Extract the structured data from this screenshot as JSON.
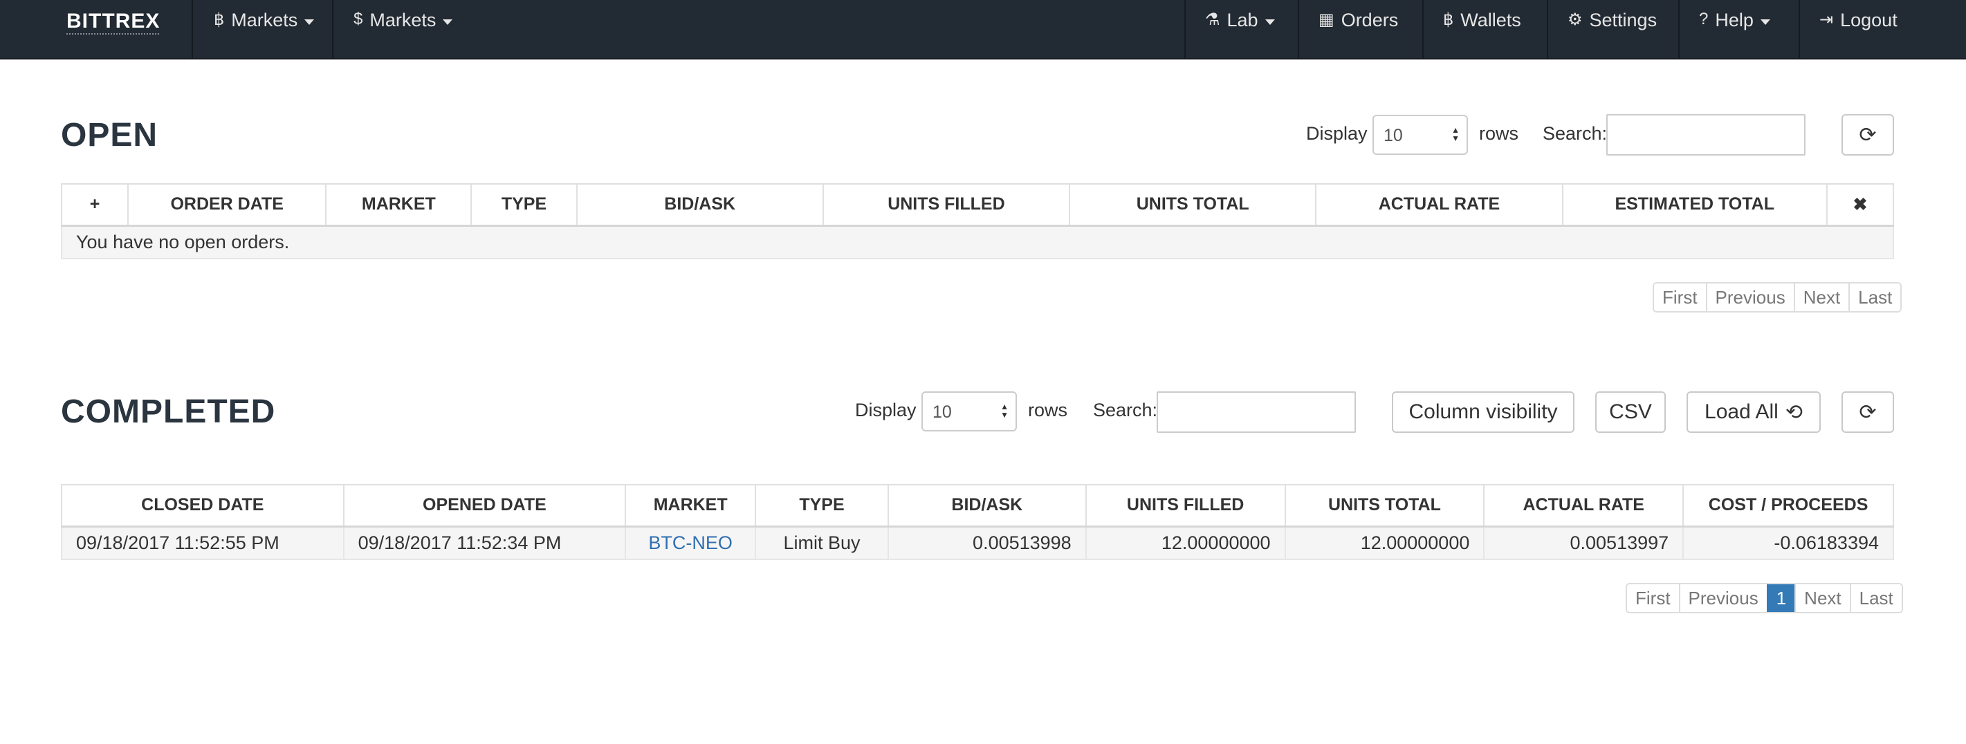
{
  "navbar": {
    "brand": "BITTREX",
    "left_items": [
      {
        "label": "Markets",
        "icon": "bitcoin-icon",
        "glyph": "฿"
      },
      {
        "label": "Markets",
        "icon": "dollar-icon",
        "glyph": "$"
      }
    ],
    "right_items": [
      {
        "label": "Lab",
        "icon": "flask-icon",
        "glyph": "⚗"
      },
      {
        "label": "Orders",
        "icon": "calendar-icon",
        "glyph": "▦"
      },
      {
        "label": "Wallets",
        "icon": "bitcoin-icon",
        "glyph": "฿"
      },
      {
        "label": "Settings",
        "icon": "gear-icon",
        "glyph": "⚙"
      },
      {
        "label": "Help",
        "icon": "question-icon",
        "glyph": "?"
      },
      {
        "label": "Logout",
        "icon": "logout-icon",
        "glyph": "⇥"
      }
    ]
  },
  "open": {
    "title": "OPEN",
    "display_label": "Display",
    "rows_value": "10",
    "rows_label": "rows",
    "search_label": "Search:",
    "search_value": "",
    "columns": [
      "+",
      "ORDER DATE",
      "MARKET",
      "TYPE",
      "BID/ASK",
      "UNITS FILLED",
      "UNITS TOTAL",
      "ACTUAL RATE",
      "ESTIMATED TOTAL",
      "✖"
    ],
    "empty_message": "You have no open orders.",
    "pager": [
      "First",
      "Previous",
      "Next",
      "Last"
    ]
  },
  "completed": {
    "title": "COMPLETED",
    "display_label": "Display",
    "rows_value": "10",
    "rows_label": "rows",
    "search_label": "Search:",
    "search_value": "",
    "column_visibility_label": "Column visibility",
    "csv_label": "CSV",
    "load_all_label": "Load All",
    "load_all_icon_glyph": "⟲",
    "columns": [
      "CLOSED DATE",
      "OPENED DATE",
      "MARKET",
      "TYPE",
      "BID/ASK",
      "UNITS FILLED",
      "UNITS TOTAL",
      "ACTUAL RATE",
      "COST / PROCEEDS"
    ],
    "rows": [
      [
        "09/18/2017 11:52:55 PM",
        "09/18/2017 11:52:34 PM",
        "BTC-NEO",
        "Limit Buy",
        "0.00513998",
        "12.00000000",
        "12.00000000",
        "0.00513997",
        "-0.06183394"
      ]
    ],
    "pager": [
      "First",
      "Previous",
      "1",
      "Next",
      "Last"
    ],
    "active_page": "1"
  },
  "colors": {
    "navbar": "#222a33",
    "link": "#2f6fb0",
    "active_page": "#337ab7"
  }
}
